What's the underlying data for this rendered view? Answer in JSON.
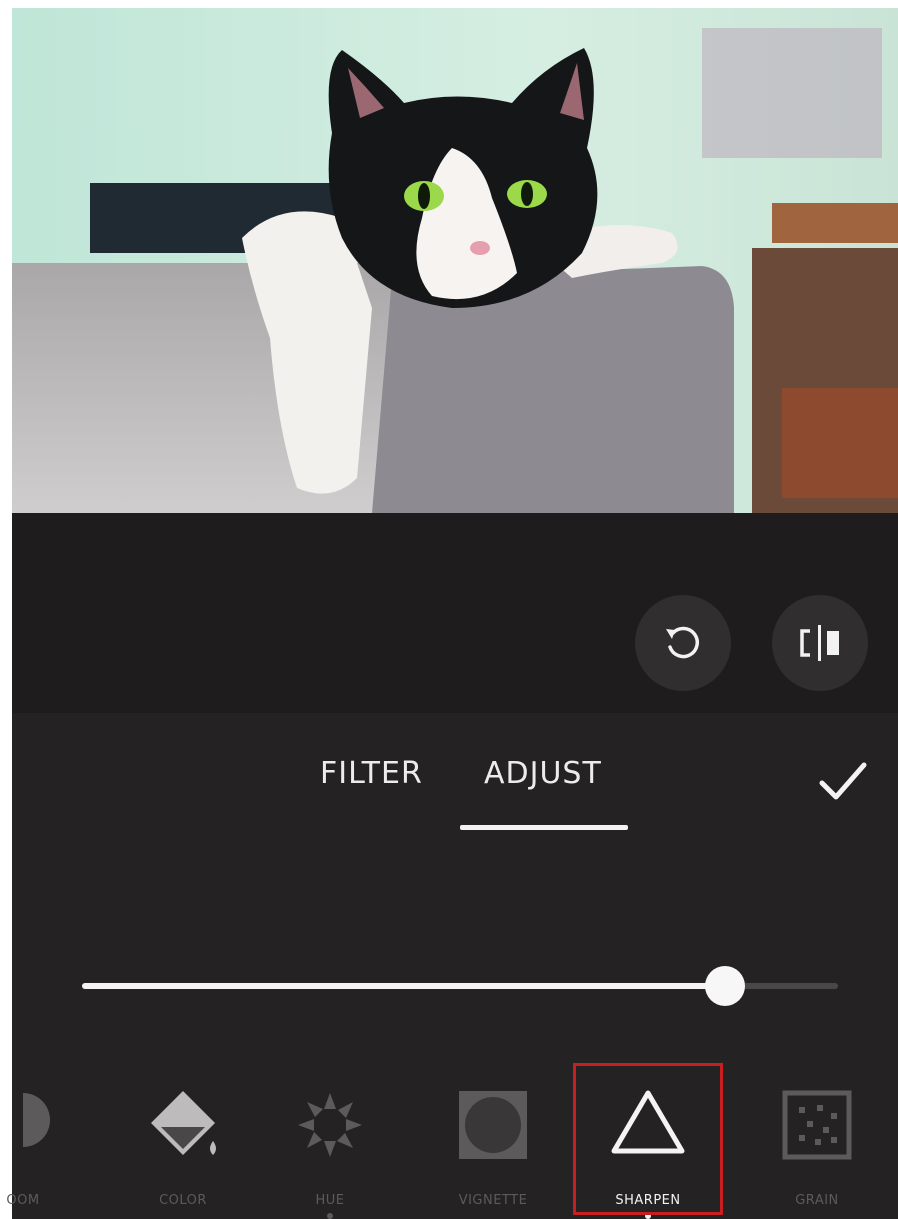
{
  "photo": {
    "subject": "cat-photo"
  },
  "actions": {
    "reset_icon": "rotate-ccw-icon",
    "compare_icon": "compare-split-icon"
  },
  "tabs": [
    {
      "label": "FILTER",
      "active": false
    },
    {
      "label": "ADJUST",
      "active": true
    }
  ],
  "confirm": {
    "icon": "checkmark-icon"
  },
  "slider": {
    "value": 0.85
  },
  "tools": [
    {
      "label": "OOM",
      "icon": "half-circle-icon",
      "active": false
    },
    {
      "label": "COLOR",
      "icon": "paint-bucket-icon",
      "active": false
    },
    {
      "label": "HUE",
      "icon": "hue-wheel-icon",
      "active": false,
      "modified": true
    },
    {
      "label": "VIGNETTE",
      "icon": "vignette-icon",
      "active": false
    },
    {
      "label": "SHARPEN",
      "icon": "triangle-icon",
      "active": true,
      "modified": true
    },
    {
      "label": "GRAIN",
      "icon": "grain-icon",
      "active": false
    }
  ],
  "colors": {
    "background": "#252224",
    "highlight": "#c81e22",
    "accent": "#f2f2f2"
  }
}
